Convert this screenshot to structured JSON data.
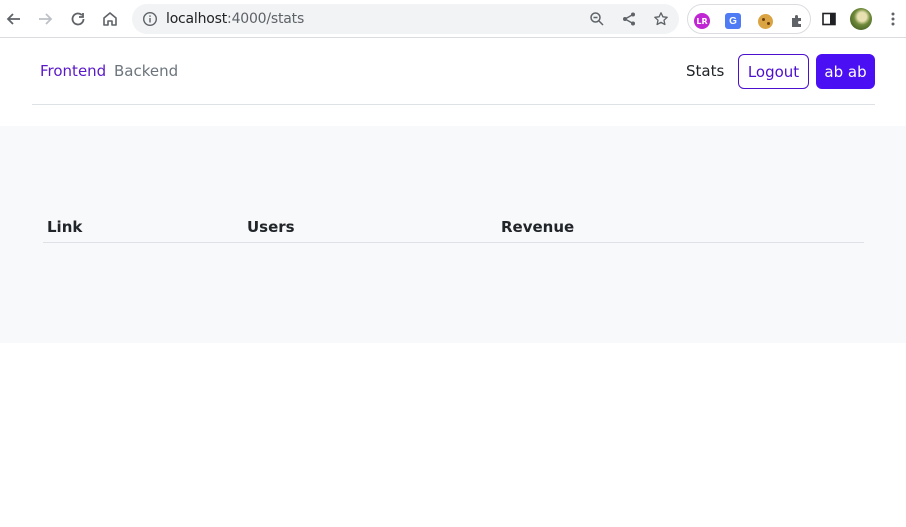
{
  "browser": {
    "url_host": "localhost",
    "url_path": ":4000/stats"
  },
  "nav": {
    "frontend": "Frontend",
    "backend": "Backend",
    "stats": "Stats",
    "logout": "Logout",
    "user": "ab ab"
  },
  "table": {
    "headers": [
      "Link",
      "Users",
      "Revenue"
    ]
  },
  "colors": {
    "primary": "#4a0ff2",
    "active_link": "#5a19c9",
    "muted_link": "#6c757d",
    "main_bg": "#f8f9fa"
  }
}
